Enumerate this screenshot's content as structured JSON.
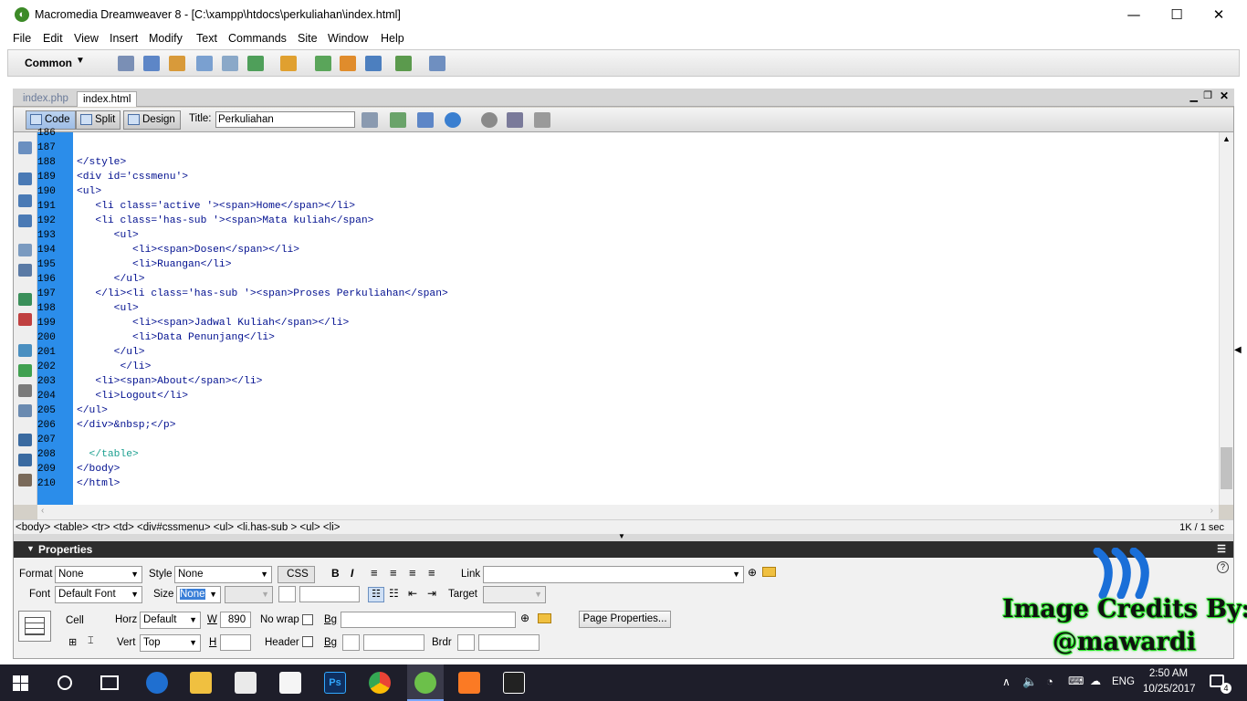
{
  "window": {
    "title": "Macromedia Dreamweaver 8 - [C:\\xampp\\htdocs\\perkuliahan\\index.html]",
    "minimize": "—",
    "maximize": "☐",
    "close": "✕"
  },
  "menu": [
    "File",
    "Edit",
    "View",
    "Insert",
    "Modify",
    "Text",
    "Commands",
    "Site",
    "Window",
    "Help"
  ],
  "insert_bar": {
    "category": "Common"
  },
  "tabs": [
    {
      "label": "index.php",
      "active": false
    },
    {
      "label": "index.html",
      "active": true
    }
  ],
  "doc_toolbar": {
    "code": "Code",
    "split": "Split",
    "design": "Design",
    "title_label": "Title:",
    "title_value": "Perkuliahan"
  },
  "code_lines": [
    {
      "n": "186",
      "text": ""
    },
    {
      "n": "187",
      "text": ""
    },
    {
      "n": "188",
      "text": "</style>"
    },
    {
      "n": "189",
      "text": "<div id='cssmenu'>"
    },
    {
      "n": "190",
      "text": "<ul>"
    },
    {
      "n": "191",
      "text": "   <li class='active '><span>Home</span></li>"
    },
    {
      "n": "192",
      "text": "   <li class='has-sub '><span>Mata kuliah</span>"
    },
    {
      "n": "193",
      "text": "      <ul>"
    },
    {
      "n": "194",
      "text": "         <li><span>Dosen</span></li>"
    },
    {
      "n": "195",
      "text": "         <li>Ruangan</li>"
    },
    {
      "n": "196",
      "text": "      </ul>"
    },
    {
      "n": "197",
      "text": "   </li><li class='has-sub '><span>Proses Perkuliahan</span>"
    },
    {
      "n": "198",
      "text": "      <ul>"
    },
    {
      "n": "199",
      "text": "         <li><span>Jadwal Kuliah</span></li>"
    },
    {
      "n": "200",
      "text": "         <li>Data Penunjang</li>"
    },
    {
      "n": "201",
      "text": "      </ul>"
    },
    {
      "n": "202",
      "text": "       </li>"
    },
    {
      "n": "203",
      "text": "   <li><span>About</span></li>"
    },
    {
      "n": "204",
      "text": "   <li>Logout</li>"
    },
    {
      "n": "205",
      "text": "</ul>"
    },
    {
      "n": "206",
      "text": "</div>&nbsp;</p>"
    },
    {
      "n": "207",
      "text": ""
    },
    {
      "n": "208",
      "text": "  </table>"
    },
    {
      "n": "209",
      "text": "</body>"
    },
    {
      "n": "210",
      "text": "</html>"
    }
  ],
  "status_bar": {
    "tag_selector": "<body> <table> <tr> <td> <div#cssmenu> <ul> <li.has-sub > <ul> <li>",
    "download_stats": "1K / 1 sec"
  },
  "properties": {
    "header": "Properties",
    "format_label": "Format",
    "format_value": "None",
    "style_label": "Style",
    "style_value": "None",
    "css_button": "CSS",
    "bold": "B",
    "italic": "I",
    "link_label": "Link",
    "font_label": "Font",
    "font_value": "Default Font",
    "size_label": "Size",
    "size_value": "None",
    "target_label": "Target",
    "cell_label": "Cell",
    "horz_label": "Horz",
    "horz_value": "Default",
    "w_label": "W",
    "w_value": "890",
    "nowrap_label": "No wrap",
    "bg_label": "Bg",
    "page_properties": "Page Properties...",
    "vert_label": "Vert",
    "vert_value": "Top",
    "h_label": "H",
    "header_label": "Header",
    "brdr_label": "Brdr"
  },
  "taskbar": {
    "lang": "ENG",
    "time": "2:50 AM",
    "date": "10/25/2017",
    "notifications": "4"
  },
  "credits": {
    "line1": "Image Credits By:",
    "line2": "@mawardi"
  }
}
